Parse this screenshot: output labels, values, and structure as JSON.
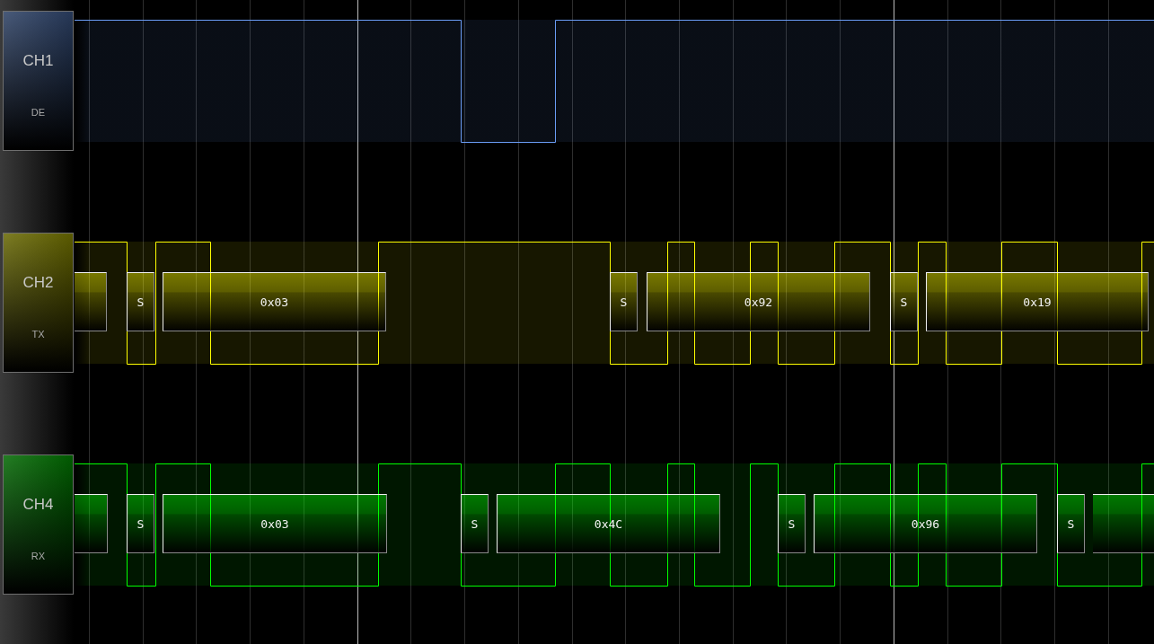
{
  "channels": [
    {
      "name": "CH1",
      "signal": "DE",
      "color": "#6a9cf5"
    },
    {
      "name": "CH2",
      "signal": "TX",
      "color": "#ffff00",
      "frames": [
        {
          "kind": "partial"
        },
        {
          "kind": "start",
          "label": "S"
        },
        {
          "kind": "byte",
          "label": "0x03"
        },
        {
          "kind": "start",
          "label": "S"
        },
        {
          "kind": "byte",
          "label": "0x92"
        },
        {
          "kind": "start",
          "label": "S"
        },
        {
          "kind": "byte",
          "label": "0x19"
        }
      ]
    },
    {
      "name": "CH4",
      "signal": "RX",
      "color": "#00ff00",
      "frames": [
        {
          "kind": "partial"
        },
        {
          "kind": "start",
          "label": "S"
        },
        {
          "kind": "byte",
          "label": "0x03"
        },
        {
          "kind": "start",
          "label": "S"
        },
        {
          "kind": "byte",
          "label": "0x4C"
        },
        {
          "kind": "start",
          "label": "S"
        },
        {
          "kind": "byte",
          "label": "0x96"
        },
        {
          "kind": "start",
          "label": "S"
        },
        {
          "kind": "partial"
        }
      ]
    }
  ]
}
